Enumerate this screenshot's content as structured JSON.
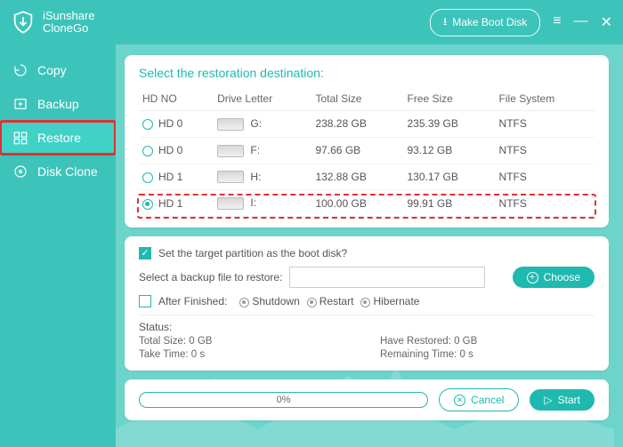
{
  "app": {
    "name1": "iSunshare",
    "name2": "CloneGo"
  },
  "titlebar": {
    "make_boot": "Make Boot Disk"
  },
  "sidebar": {
    "items": [
      {
        "label": "Copy"
      },
      {
        "label": "Backup"
      },
      {
        "label": "Restore"
      },
      {
        "label": "Disk Clone"
      }
    ]
  },
  "panel": {
    "title": "Select the restoration destination:",
    "headers": {
      "hd": "HD NO",
      "drive": "Drive Letter",
      "total": "Total Size",
      "free": "Free Size",
      "fs": "File System"
    },
    "rows": [
      {
        "hd": "HD 0",
        "letter": "G:",
        "total": "238.28 GB",
        "free": "235.39 GB",
        "fs": "NTFS",
        "selected": false
      },
      {
        "hd": "HD 0",
        "letter": "F:",
        "total": "97.66 GB",
        "free": "93.12 GB",
        "fs": "NTFS",
        "selected": false
      },
      {
        "hd": "HD 1",
        "letter": "H:",
        "total": "132.88 GB",
        "free": "130.17 GB",
        "fs": "NTFS",
        "selected": false
      },
      {
        "hd": "HD 1",
        "letter": "I:",
        "total": "100.00 GB",
        "free": "99.91 GB",
        "fs": "NTFS",
        "selected": true
      }
    ]
  },
  "options": {
    "set_boot": "Set the target partition as the boot disk?",
    "select_backup": "Select a backup file to restore:",
    "choose": "Choose",
    "after_finished": "After Finished:",
    "shutdown": "Shutdown",
    "restart": "Restart",
    "hibernate": "Hibernate"
  },
  "status": {
    "label": "Status:",
    "total": "Total Size: 0 GB",
    "restored": "Have Restored: 0 GB",
    "take": "Take Time: 0 s",
    "remain": "Remaining Time: 0 s"
  },
  "footer": {
    "progress": "0%",
    "cancel": "Cancel",
    "start": "Start"
  }
}
